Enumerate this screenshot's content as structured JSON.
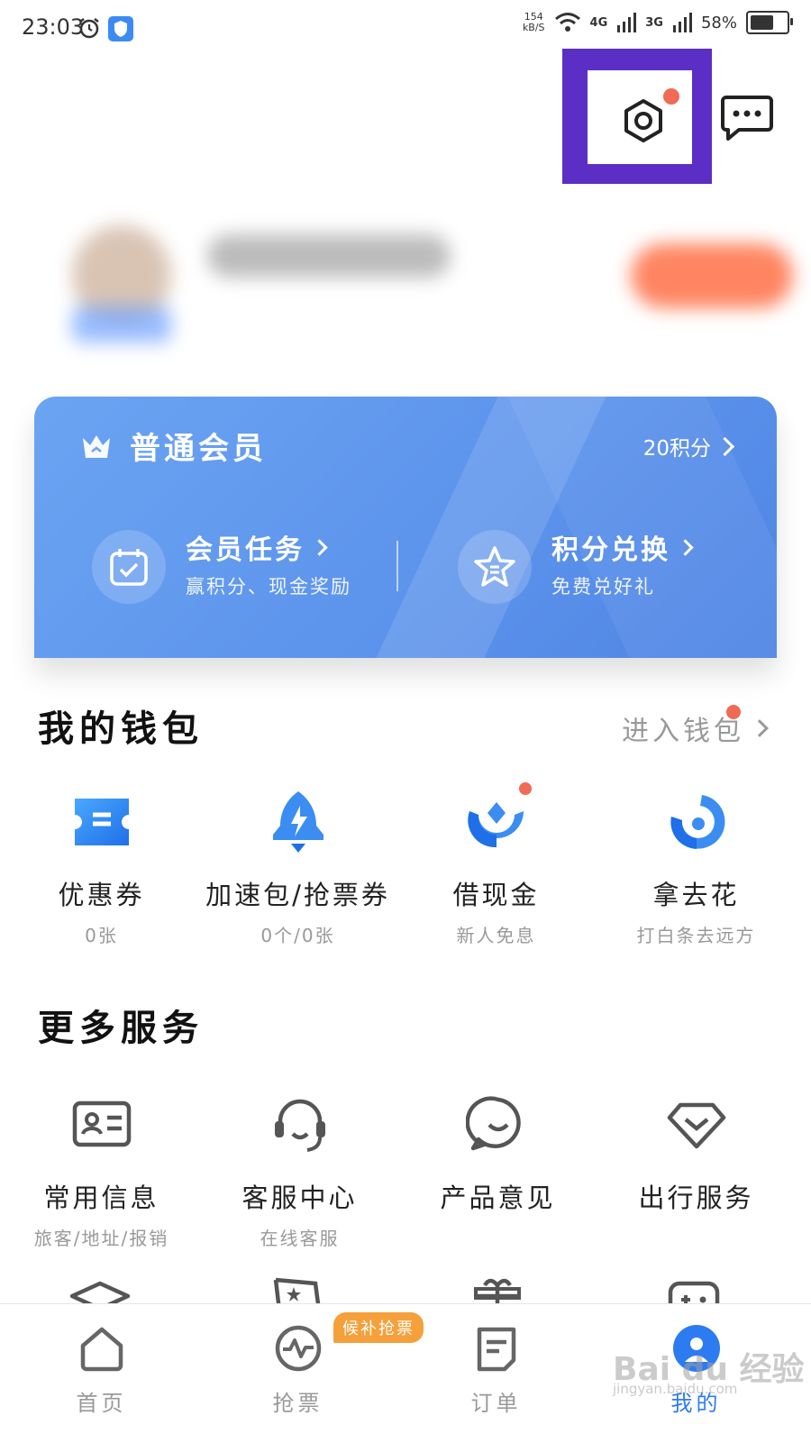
{
  "status_bar": {
    "time": "23:03",
    "net_rate_value": "154",
    "net_rate_unit": "kB/S",
    "net1": "4G",
    "net2": "3G",
    "battery": "58%"
  },
  "member_card": {
    "level": "普通会员",
    "points": "20积分",
    "task_title": "会员任务",
    "task_sub": "赢积分、现金奖励",
    "exchange_title": "积分兑换",
    "exchange_sub": "免费兑好礼"
  },
  "wallet": {
    "title": "我的钱包",
    "link": "进入钱包",
    "items": [
      {
        "label": "优惠券",
        "sub": "0张",
        "icon": "coupon-icon"
      },
      {
        "label": "加速包/抢票券",
        "sub": "0个/0张",
        "icon": "rocket-icon"
      },
      {
        "label": "借现金",
        "sub": "新人免息",
        "icon": "cash-loan-icon"
      },
      {
        "label": "拿去花",
        "sub": "打白条去远方",
        "icon": "credit-icon"
      }
    ]
  },
  "more_services": {
    "title": "更多服务",
    "items": [
      {
        "label": "常用信息",
        "sub": "旅客/地址/报销",
        "icon": "id-card-icon"
      },
      {
        "label": "客服中心",
        "sub": "在线客服",
        "icon": "headset-icon"
      },
      {
        "label": "产品意见",
        "sub": "",
        "icon": "feedback-icon"
      },
      {
        "label": "出行服务",
        "sub": "",
        "icon": "diamond-icon"
      }
    ]
  },
  "bottom_nav": {
    "items": [
      {
        "label": "首页",
        "icon": "home-icon"
      },
      {
        "label": "抢票",
        "icon": "ticket-grab-icon"
      },
      {
        "label": "订单",
        "icon": "order-icon"
      },
      {
        "label": "我的",
        "icon": "profile-icon"
      }
    ],
    "badge": "候补抢票",
    "active_index": 3
  },
  "watermark": {
    "text": "Bai du 经验",
    "sub": "jingyan.baidu.com"
  },
  "colors": {
    "accent": "#2d7bf0",
    "card": "#5d94ec",
    "highlight": "#5b2ec6",
    "dot": "#f06b55",
    "badge": "#f5a03a"
  }
}
